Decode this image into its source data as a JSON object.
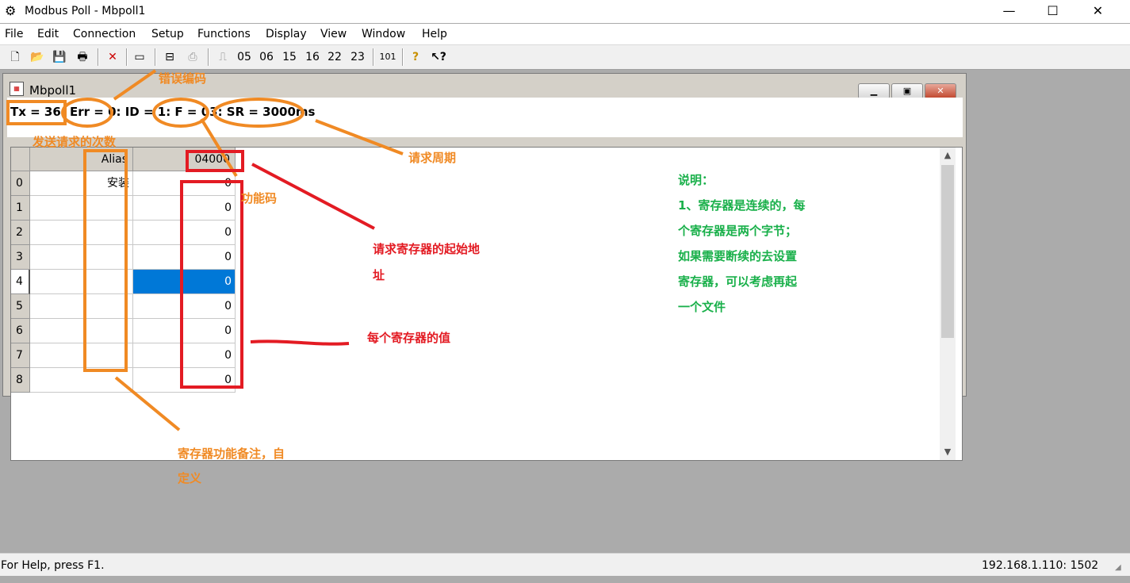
{
  "window": {
    "title": "Modbus Poll - Mbpoll1",
    "icon": "modbus-app-icon",
    "controls": [
      "minimize-icon",
      "maximize-icon",
      "close-icon"
    ]
  },
  "menu": [
    "File",
    "Edit",
    "Connection",
    "Setup",
    "Functions",
    "Display",
    "View",
    "Window",
    "Help"
  ],
  "toolbar": {
    "icons": [
      "new-document-icon",
      "open-folder-icon",
      "save-disk-icon",
      "print-icon",
      "disconnect-x-icon",
      "window-icon",
      "read-write-icon",
      "print-preview-icon",
      "pulse-icon"
    ],
    "function_buttons": [
      "05",
      "06",
      "15",
      "16",
      "22",
      "23",
      "101"
    ],
    "help_icons": [
      "help-icon",
      "context-help-icon"
    ]
  },
  "mdi": {
    "title": "Mbpoll1",
    "status_line": "Tx = 36: Err = 0: ID = 1: F = 03: SR = 3000ms"
  },
  "table": {
    "alias_header": "Alias",
    "address_header": "04000",
    "rows": [
      {
        "index": "0",
        "alias": "安装",
        "value": "0"
      },
      {
        "index": "1",
        "alias": "",
        "value": "0"
      },
      {
        "index": "2",
        "alias": "",
        "value": "0"
      },
      {
        "index": "3",
        "alias": "",
        "value": "0"
      },
      {
        "index": "4",
        "alias": "",
        "value": "0",
        "selected": true
      },
      {
        "index": "5",
        "alias": "",
        "value": "0"
      },
      {
        "index": "6",
        "alias": "",
        "value": "0"
      },
      {
        "index": "7",
        "alias": "",
        "value": "0"
      },
      {
        "index": "8",
        "alias": "",
        "value": "0"
      }
    ]
  },
  "annotations": {
    "error_code": "错误编码",
    "tx_count": "发送请求的次数",
    "request_period": "请求周期",
    "function_code": "功能码",
    "start_address_line1": "请求寄存器的起始地",
    "start_address_line2": "址",
    "register_value": "每个寄存器的值",
    "alias_note_line1": "寄存器功能备注，自",
    "alias_note_line2": "定义",
    "notes": [
      "说明：",
      "1、寄存器是连续的，每",
      "个寄存器是两个字节；",
      "如果需要断续的去设置",
      "寄存器，可以考虑再起",
      "一个文件"
    ]
  },
  "colors": {
    "orange_annotation": "#f08a24",
    "red_annotation": "#e31b23",
    "green_annotation": "#19b04a",
    "selected_cell": "#0078d7"
  },
  "statusbar": {
    "help_text": "For Help, press F1.",
    "connection": "192.168.1.110: 1502"
  }
}
